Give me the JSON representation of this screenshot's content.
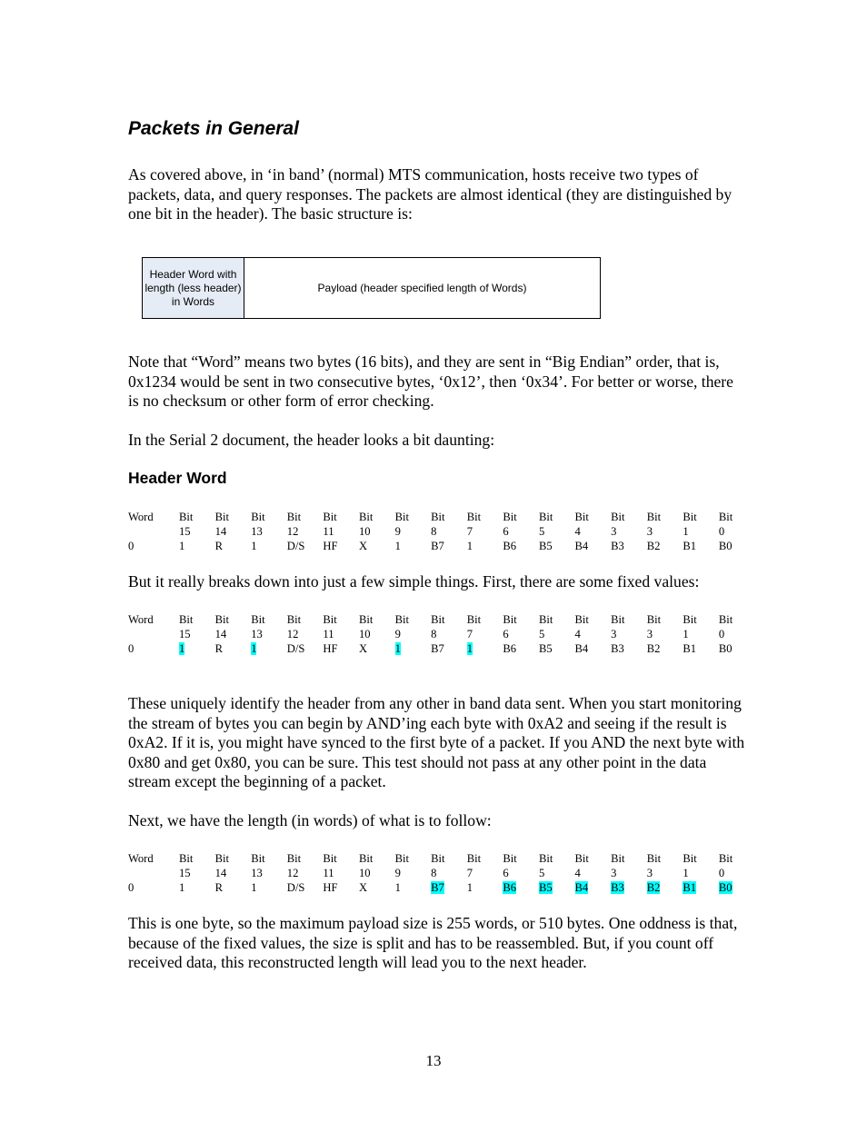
{
  "heading": "Packets in General",
  "paragraphs": {
    "intro": "As covered above, in ‘in band’ (normal) MTS communication, hosts receive two types of packets, data, and query responses. The packets are almost identical (they are distinguished by one bit in the header). The basic structure is:",
    "word_note": "Note that “Word” means two bytes (16 bits), and they are sent in “Big Endian” order, that is, 0x1234 would be sent in two consecutive bytes, ‘0x12’, then ‘0x34’. For better or worse, there is no checksum or other form of error checking.",
    "serial2": "In the Serial 2 document, the header looks a bit daunting:",
    "breaks_down": "But it really breaks down into just a few simple things. First, there are some fixed values:",
    "uniquely": "These uniquely identify the header from any other in band data sent. When you start monitoring the stream of bytes you can begin by AND’ing each byte with 0xA2 and seeing if the result is 0xA2. If it is, you might have synced to the first byte of a packet. If you AND the next byte with 0x80 and get 0x80, you can be sure. This test should not pass at any other point in the data stream except the beginning of a packet.",
    "next_length": "Next, we have the length (in words) of what is to follow:",
    "one_byte": "This is one byte, so the maximum payload size is 255 words, or 510 bytes. One oddness is that, because of the fixed values, the size is split and has to be reassembled. But, if you count off received data, this reconstructed length will lead you to the next header."
  },
  "structure_diagram": {
    "header_cell": "Header Word with length (less header) in Words",
    "payload_cell": "Payload (header specified length of Words)",
    "header_fill": "#e6ecf6"
  },
  "subheading": "Header Word",
  "bit_table": {
    "word_label": "Word",
    "word_index": "0",
    "bit_label": "Bit",
    "bit_numbers": [
      "15",
      "14",
      "13",
      "12",
      "11",
      "10",
      "9",
      "8",
      "7",
      "6",
      "5",
      "4",
      "3",
      "3",
      "1",
      "0"
    ],
    "values": [
      "1",
      "R",
      "1",
      "D/S",
      "HF",
      "X",
      "1",
      "B7",
      "1",
      "B6",
      "B5",
      "B4",
      "B3",
      "B2",
      "B1",
      "B0"
    ],
    "highlight_color": "#00ffff"
  },
  "tables": [
    {
      "highlighted": []
    },
    {
      "highlighted": [
        0,
        2,
        6,
        8
      ]
    },
    {
      "highlighted": [
        7,
        9,
        10,
        11,
        12,
        13,
        14,
        15
      ]
    }
  ],
  "page_number": "13"
}
